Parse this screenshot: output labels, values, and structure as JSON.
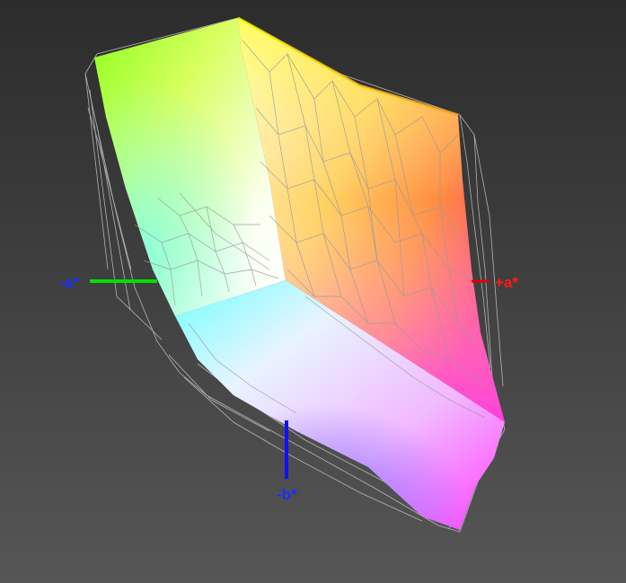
{
  "viewer": {
    "background_top": "#2c2c2c",
    "background_bottom": "#565656"
  },
  "axes": {
    "neg_a": {
      "label": "-a*",
      "color": "#00e000",
      "label_color": "#1a2cff"
    },
    "pos_a": {
      "label": "+a*",
      "color": "#e00000",
      "label_color": "#ff1a1a"
    },
    "neg_b": {
      "label": "-b*",
      "color": "#1010ff",
      "label_color": "#1a2cff"
    }
  },
  "gamut": {
    "solid_corners": {
      "yellow": "#ffff00",
      "green": "#8cff1e",
      "white": "#ffffff",
      "orange": "#ff9c10",
      "red": "#ff3c50",
      "magenta": "#ff40ff",
      "cyan": "#60ffff",
      "blue": "#8a6cff",
      "violet": "#b050ff"
    },
    "wireframe_color": "#cfcfcf"
  }
}
